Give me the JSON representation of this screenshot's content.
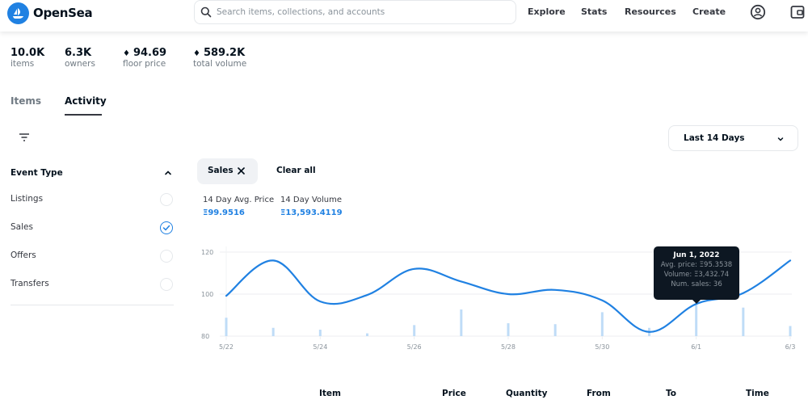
{
  "header": {
    "brand": "OpenSea",
    "search_placeholder": "Search items, collections, and accounts",
    "search_value": "",
    "nav": [
      "Explore",
      "Stats",
      "Resources",
      "Create"
    ],
    "icons": [
      "account-icon",
      "wallet-icon"
    ]
  },
  "stats": [
    {
      "value": "10.0K",
      "label": "items",
      "eth": false
    },
    {
      "value": "6.3K",
      "label": "owners",
      "eth": false
    },
    {
      "value": "94.69",
      "label": "floor price",
      "eth": true
    },
    {
      "value": "589.2K",
      "label": "total volume",
      "eth": true
    }
  ],
  "tabs": [
    {
      "label": "Items",
      "active": false
    },
    {
      "label": "Activity",
      "active": true
    }
  ],
  "sidebar": {
    "section_title": "Event Type",
    "events": [
      {
        "label": "Listings",
        "checked": false
      },
      {
        "label": "Sales",
        "checked": true
      },
      {
        "label": "Offers",
        "checked": false
      },
      {
        "label": "Transfers",
        "checked": false
      }
    ]
  },
  "range_select": {
    "value": "Last 14 Days"
  },
  "filters": {
    "chips": [
      {
        "label": "Sales"
      }
    ],
    "clear_all": "Clear all"
  },
  "kpis": [
    {
      "label": "14 Day Avg. Price",
      "value": "Ξ99.9516"
    },
    {
      "label": "14 Day Volume",
      "value": "Ξ13,593.4119"
    }
  ],
  "tooltip": {
    "date": "Jun 1, 2022",
    "avg_price": "Avg. price: Ξ95.3538",
    "volume": "Volume: Ξ3,432.74",
    "num_sales": "Num. sales: 36"
  },
  "table": {
    "columns": [
      "Item",
      "Price",
      "Quantity",
      "From",
      "To",
      "Time"
    ]
  },
  "colors": {
    "accent": "#2081e2",
    "bar": "#bfdcf7",
    "text": "#04111d",
    "muted": "#707a83"
  },
  "chart_data": {
    "type": "line",
    "title": "",
    "xlabel": "",
    "ylabel": "Avg. price",
    "x": [
      "5/22",
      "5/23",
      "5/24",
      "5/25",
      "5/26",
      "5/27",
      "5/28",
      "5/29",
      "5/30",
      "5/31",
      "6/1",
      "6/2",
      "6/3"
    ],
    "x_tick_labels": [
      "5/22",
      "5/24",
      "5/26",
      "5/28",
      "5/30",
      "6/1",
      "6/3"
    ],
    "y_ticks": [
      80,
      100,
      120
    ],
    "ylim": [
      80,
      120
    ],
    "grid": true,
    "legend": "none",
    "series": [
      {
        "name": "Avg. price",
        "type": "line",
        "values": [
          99.2,
          116,
          96.5,
          99.6,
          112,
          106,
          100,
          102,
          97,
          82,
          95.35,
          100.5,
          116
        ]
      },
      {
        "name": "Num. sales",
        "type": "bar",
        "values": [
          20,
          9,
          7,
          3,
          12,
          29,
          14,
          13,
          26,
          9,
          36,
          31,
          11
        ]
      }
    ],
    "highlight": {
      "x": "6/1",
      "avg_price": 95.3538,
      "volume": 3432.74,
      "num_sales": 36
    }
  }
}
